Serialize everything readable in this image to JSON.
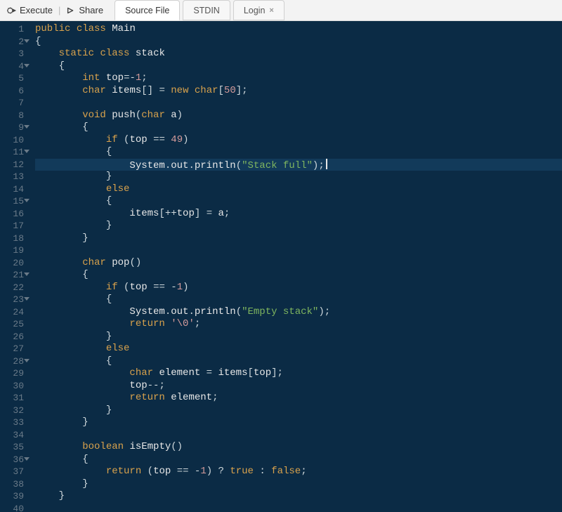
{
  "toolbar": {
    "execute_label": "Execute",
    "share_label": "Share"
  },
  "tabs": {
    "source": "Source File",
    "stdin": "STDIN",
    "login": "Login"
  },
  "editor": {
    "highlight_line": 12,
    "fold_lines": [
      2,
      4,
      9,
      11,
      15,
      21,
      23,
      28,
      36
    ],
    "lines": [
      [
        [
          "kw",
          "public"
        ],
        [
          "sp",
          " "
        ],
        [
          "kw",
          "class"
        ],
        [
          "sp",
          " "
        ],
        [
          "id",
          "Main"
        ]
      ],
      [
        [
          "punc",
          "{"
        ]
      ],
      [
        [
          "sp",
          "    "
        ],
        [
          "kw",
          "static"
        ],
        [
          "sp",
          " "
        ],
        [
          "kw",
          "class"
        ],
        [
          "sp",
          " "
        ],
        [
          "id",
          "stack"
        ]
      ],
      [
        [
          "sp",
          "    "
        ],
        [
          "punc",
          "{"
        ]
      ],
      [
        [
          "sp",
          "        "
        ],
        [
          "type",
          "int"
        ],
        [
          "sp",
          " "
        ],
        [
          "id",
          "top"
        ],
        [
          "op",
          "=-"
        ],
        [
          "num",
          "1"
        ],
        [
          "punc",
          ";"
        ]
      ],
      [
        [
          "sp",
          "        "
        ],
        [
          "type",
          "char"
        ],
        [
          "sp",
          " "
        ],
        [
          "id",
          "items"
        ],
        [
          "punc",
          "[]"
        ],
        [
          "sp",
          " "
        ],
        [
          "op",
          "="
        ],
        [
          "sp",
          " "
        ],
        [
          "kw",
          "new"
        ],
        [
          "sp",
          " "
        ],
        [
          "type",
          "char"
        ],
        [
          "punc",
          "["
        ],
        [
          "num",
          "50"
        ],
        [
          "punc",
          "];"
        ]
      ],
      [],
      [
        [
          "sp",
          "        "
        ],
        [
          "type",
          "void"
        ],
        [
          "sp",
          " "
        ],
        [
          "id",
          "push"
        ],
        [
          "punc",
          "("
        ],
        [
          "type",
          "char"
        ],
        [
          "sp",
          " "
        ],
        [
          "id",
          "a"
        ],
        [
          "punc",
          ")"
        ]
      ],
      [
        [
          "sp",
          "        "
        ],
        [
          "punc",
          "{"
        ]
      ],
      [
        [
          "sp",
          "            "
        ],
        [
          "kw",
          "if"
        ],
        [
          "sp",
          " "
        ],
        [
          "punc",
          "("
        ],
        [
          "id",
          "top"
        ],
        [
          "sp",
          " "
        ],
        [
          "op",
          "=="
        ],
        [
          "sp",
          " "
        ],
        [
          "num",
          "49"
        ],
        [
          "punc",
          ")"
        ]
      ],
      [
        [
          "sp",
          "            "
        ],
        [
          "punc",
          "{"
        ]
      ],
      [
        [
          "sp",
          "                "
        ],
        [
          "id",
          "System"
        ],
        [
          "punc",
          "."
        ],
        [
          "id",
          "out"
        ],
        [
          "punc",
          "."
        ],
        [
          "id",
          "println"
        ],
        [
          "punc",
          "("
        ],
        [
          "str",
          "\"Stack full\""
        ],
        [
          "punc",
          ");"
        ],
        [
          "cursor",
          ""
        ]
      ],
      [
        [
          "sp",
          "            "
        ],
        [
          "punc",
          "}"
        ]
      ],
      [
        [
          "sp",
          "            "
        ],
        [
          "kw",
          "else"
        ]
      ],
      [
        [
          "sp",
          "            "
        ],
        [
          "punc",
          "{"
        ]
      ],
      [
        [
          "sp",
          "                "
        ],
        [
          "id",
          "items"
        ],
        [
          "punc",
          "[++"
        ],
        [
          "id",
          "top"
        ],
        [
          "punc",
          "]"
        ],
        [
          "sp",
          " "
        ],
        [
          "op",
          "="
        ],
        [
          "sp",
          " "
        ],
        [
          "id",
          "a"
        ],
        [
          "punc",
          ";"
        ]
      ],
      [
        [
          "sp",
          "            "
        ],
        [
          "punc",
          "}"
        ]
      ],
      [
        [
          "sp",
          "        "
        ],
        [
          "punc",
          "}"
        ]
      ],
      [],
      [
        [
          "sp",
          "        "
        ],
        [
          "type",
          "char"
        ],
        [
          "sp",
          " "
        ],
        [
          "id",
          "pop"
        ],
        [
          "punc",
          "()"
        ]
      ],
      [
        [
          "sp",
          "        "
        ],
        [
          "punc",
          "{"
        ]
      ],
      [
        [
          "sp",
          "            "
        ],
        [
          "kw",
          "if"
        ],
        [
          "sp",
          " "
        ],
        [
          "punc",
          "("
        ],
        [
          "id",
          "top"
        ],
        [
          "sp",
          " "
        ],
        [
          "op",
          "=="
        ],
        [
          "sp",
          " "
        ],
        [
          "op",
          "-"
        ],
        [
          "num",
          "1"
        ],
        [
          "punc",
          ")"
        ]
      ],
      [
        [
          "sp",
          "            "
        ],
        [
          "punc",
          "{"
        ]
      ],
      [
        [
          "sp",
          "                "
        ],
        [
          "id",
          "System"
        ],
        [
          "punc",
          "."
        ],
        [
          "id",
          "out"
        ],
        [
          "punc",
          "."
        ],
        [
          "id",
          "println"
        ],
        [
          "punc",
          "("
        ],
        [
          "str",
          "\"Empty stack\""
        ],
        [
          "punc",
          ");"
        ]
      ],
      [
        [
          "sp",
          "                "
        ],
        [
          "kw",
          "return"
        ],
        [
          "sp",
          " "
        ],
        [
          "char",
          "'\\0'"
        ],
        [
          "punc",
          ";"
        ]
      ],
      [
        [
          "sp",
          "            "
        ],
        [
          "punc",
          "}"
        ]
      ],
      [
        [
          "sp",
          "            "
        ],
        [
          "kw",
          "else"
        ]
      ],
      [
        [
          "sp",
          "            "
        ],
        [
          "punc",
          "{"
        ]
      ],
      [
        [
          "sp",
          "                "
        ],
        [
          "type",
          "char"
        ],
        [
          "sp",
          " "
        ],
        [
          "id",
          "element"
        ],
        [
          "sp",
          " "
        ],
        [
          "op",
          "="
        ],
        [
          "sp",
          " "
        ],
        [
          "id",
          "items"
        ],
        [
          "punc",
          "["
        ],
        [
          "id",
          "top"
        ],
        [
          "punc",
          "];"
        ]
      ],
      [
        [
          "sp",
          "                "
        ],
        [
          "id",
          "top"
        ],
        [
          "op",
          "--"
        ],
        [
          "punc",
          ";"
        ]
      ],
      [
        [
          "sp",
          "                "
        ],
        [
          "kw",
          "return"
        ],
        [
          "sp",
          " "
        ],
        [
          "id",
          "element"
        ],
        [
          "punc",
          ";"
        ]
      ],
      [
        [
          "sp",
          "            "
        ],
        [
          "punc",
          "}"
        ]
      ],
      [
        [
          "sp",
          "        "
        ],
        [
          "punc",
          "}"
        ]
      ],
      [],
      [
        [
          "sp",
          "        "
        ],
        [
          "type",
          "boolean"
        ],
        [
          "sp",
          " "
        ],
        [
          "id",
          "isEmpty"
        ],
        [
          "punc",
          "()"
        ]
      ],
      [
        [
          "sp",
          "        "
        ],
        [
          "punc",
          "{"
        ]
      ],
      [
        [
          "sp",
          "            "
        ],
        [
          "kw",
          "return"
        ],
        [
          "sp",
          " "
        ],
        [
          "punc",
          "("
        ],
        [
          "id",
          "top"
        ],
        [
          "sp",
          " "
        ],
        [
          "op",
          "=="
        ],
        [
          "sp",
          " "
        ],
        [
          "op",
          "-"
        ],
        [
          "num",
          "1"
        ],
        [
          "punc",
          ")"
        ],
        [
          "sp",
          " "
        ],
        [
          "op",
          "?"
        ],
        [
          "sp",
          " "
        ],
        [
          "bool",
          "true"
        ],
        [
          "sp",
          " "
        ],
        [
          "op",
          ":"
        ],
        [
          "sp",
          " "
        ],
        [
          "bool",
          "false"
        ],
        [
          "punc",
          ";"
        ]
      ],
      [
        [
          "sp",
          "        "
        ],
        [
          "punc",
          "}"
        ]
      ],
      [
        [
          "sp",
          "    "
        ],
        [
          "punc",
          "}"
        ]
      ],
      []
    ]
  }
}
